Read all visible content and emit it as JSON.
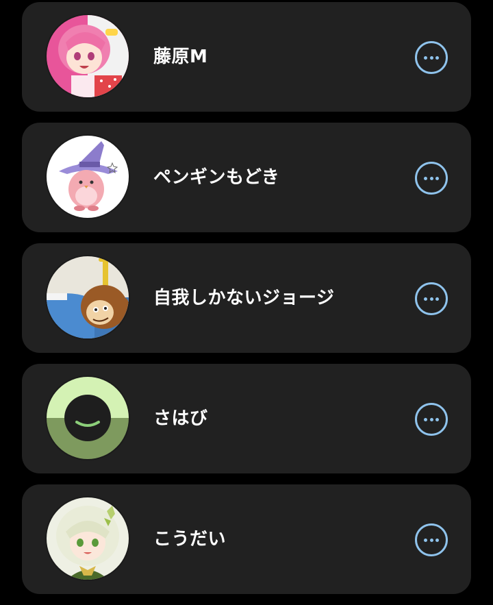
{
  "contacts": [
    {
      "name": "藤原M",
      "avatar_icon": "pink-haired-anime-girl-avatar",
      "more_icon": "more-options-icon"
    },
    {
      "name": "ペンギンもどき",
      "avatar_icon": "penguin-witch-hat-avatar",
      "more_icon": "more-options-icon"
    },
    {
      "name": "自我しかないジョージ",
      "avatar_icon": "cartoon-monkey-avatar",
      "more_icon": "more-options-icon"
    },
    {
      "name": "さはび",
      "avatar_icon": "green-smiley-circle-avatar",
      "more_icon": "more-options-icon"
    },
    {
      "name": "こうだい",
      "avatar_icon": "white-haired-anime-girl-avatar",
      "more_icon": "more-options-icon"
    }
  ],
  "colors": {
    "background": "#000000",
    "card": "#212121",
    "text": "#ffffff",
    "accent": "#8fc3ec"
  }
}
